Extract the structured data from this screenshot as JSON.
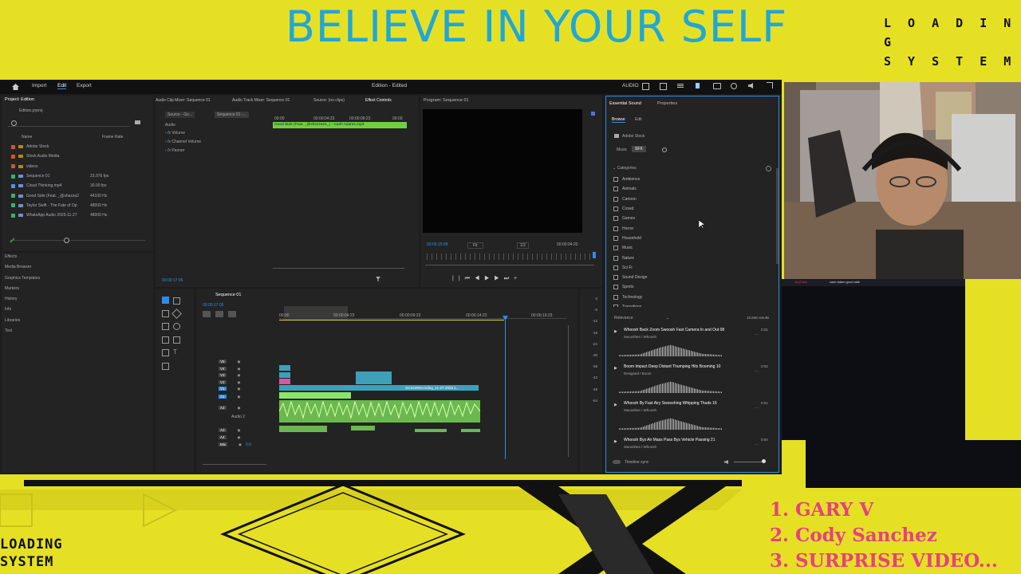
{
  "banner": {
    "title": "BELIEVE IN YOUR SELF",
    "loading_top": [
      "L O A D I N G",
      "S Y S T E M"
    ],
    "loading_bottom": [
      "LOADING",
      "SYSTEM"
    ],
    "list": [
      "1. GARY V",
      "2. Cody Sanchez",
      "3. SURPRISE VIDEO..."
    ]
  },
  "colors": {
    "background": "#e6e024",
    "title": "#1fa7d8",
    "list": "#e8407e",
    "accent_blue": "#2d8ceb",
    "audio_green": "#8ee36c",
    "clip_teal": "#3ea0b8"
  },
  "topbar": {
    "menu": [
      "Import",
      "Edit",
      "Export"
    ],
    "window_title": "Edition - Edited",
    "audio_label": "AUDIO"
  },
  "project": {
    "title": "Project: Edition",
    "file": "Edition.prproj",
    "col_name": "Name",
    "col_frame": "Frame Rate",
    "items": [
      {
        "name": "Adobe Stock",
        "frame": "",
        "color": "#d0552b",
        "icon": "folder"
      },
      {
        "name": "Stock Audio Media",
        "frame": "",
        "color": "#d0552b",
        "icon": "folder"
      },
      {
        "name": "videos",
        "frame": "",
        "color": "#d0552b",
        "icon": "folder"
      },
      {
        "name": "Sequence 01",
        "frame": "23.976 fps",
        "color": "#38b06b",
        "icon": "sequence"
      },
      {
        "name": "Cloud Thinking.mp4",
        "frame": "30.00 fps",
        "color": "#5a8fd8",
        "icon": "video"
      },
      {
        "name": "Good Side (Feat. _@shezza2",
        "frame": "44100 Hz",
        "color": "#38b06b",
        "icon": "audio"
      },
      {
        "name": "Taylor Swift - The Fate of Op",
        "frame": "48000 Hz",
        "color": "#38b06b",
        "icon": "audio"
      },
      {
        "name": "WhatsApp Audio 2025-11-27",
        "frame": "48000 Hz",
        "color": "#38b06b",
        "icon": "audio"
      }
    ]
  },
  "left_list": [
    "Effects",
    "Media Browser",
    "Graphics Templates",
    "Markers",
    "History",
    "Info",
    "Libraries",
    "Text"
  ],
  "source_tabs": [
    "Audio Clip Mixer: Sequence 01",
    "Audio Track Mixer: Sequence 01",
    "Source: (no clips)",
    "Effect Controls"
  ],
  "effect_controls": {
    "source": "Source - Go...",
    "sequence": "Sequence 01 -...",
    "section": "Audio",
    "rows": [
      "Volume",
      "Channel Volume",
      "Panner"
    ],
    "clip": "Good Side (Feat. _@shezza21_) - Cash Adams.mp3",
    "times": [
      "00:00",
      "00:00:04:23",
      "00:00:09:23",
      "00:00"
    ],
    "timecode": "00:00:17:05"
  },
  "program": {
    "tab": "Program: Sequence 01",
    "timecode": "00:00:15:08",
    "fit": "Fit",
    "ratio": "1/2",
    "duration": "00:00:04:20"
  },
  "timeline": {
    "tab": "Sequence 01",
    "timecode": "00:00:17:05",
    "ruler": [
      "00:00",
      "00:00:04:23",
      "00:00:09:23",
      "00:00:14:23",
      "00:00:19:23"
    ],
    "tracks": [
      "V5",
      "V4",
      "V3",
      "V2",
      "V1",
      "A1",
      "A2",
      "A3",
      "A4",
      "Mix"
    ],
    "audio2_label": "Audio 2",
    "mix_value": "0.0",
    "clip_label": "ScreenRecording_11-27-2025 1...",
    "meter": [
      "0",
      "-6",
      "-12",
      "-18",
      "-24",
      "-30",
      "-36",
      "-42",
      "-48",
      "-54"
    ]
  },
  "essential": {
    "tabs": [
      "Essential Sound",
      "Properties"
    ],
    "subtabs": [
      "Browse",
      "Edit"
    ],
    "source": "Adobe Stock",
    "type_tabs": [
      "Music",
      "SFX"
    ],
    "categories_label": "Categories",
    "categories": [
      "Ambience",
      "Animals",
      "Cartoon",
      "Crowd",
      "Games",
      "Horror",
      "Household",
      "Music",
      "Nature",
      "Sci Fi",
      "Sound Design",
      "Sports",
      "Technology",
      "Transitions"
    ],
    "sort": "Relevance",
    "results": "15,556 results",
    "sounds": [
      {
        "title": "Whoosh Back Zoom Swoosh Fast Camera In and Out 08",
        "sub": "Swooshes / Whoosh",
        "dur": "0:01"
      },
      {
        "title": "Boom Impact Deep Distant Thumping Hits Booming 10",
        "sub": "Designed / Boom",
        "dur": "0:02"
      },
      {
        "title": "Whoosh By Fast Airy Swooshing Whipping Thuds 16",
        "sub": "Swooshes / Whoosh",
        "dur": "0:01"
      },
      {
        "title": "Whoosh Bys Air Mass Pass Bys Vehicle Passing 21",
        "sub": "Swooshes / Whoosh",
        "dur": "0:04"
      }
    ],
    "timeline_sync": "Timeline sync"
  },
  "browser": {
    "site": "YouTube",
    "query": "cash adam good side"
  }
}
